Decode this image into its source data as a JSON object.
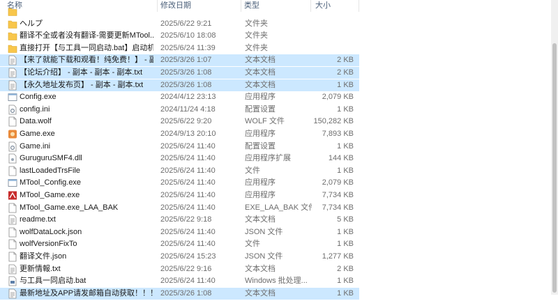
{
  "columns": {
    "name": "名称",
    "date": "修改日期",
    "type": "类型",
    "size": "大小"
  },
  "rows": [
    {
      "name": "",
      "date": "",
      "type": "",
      "size": "",
      "icon": "folder-icon",
      "selected": false,
      "partial": true
    },
    {
      "name": "ヘルプ",
      "date": "2025/6/22 9:21",
      "type": "文件夹",
      "size": "",
      "icon": "folder-icon",
      "selected": false
    },
    {
      "name": "翻译不全或者没有翻译-需要更新MTool...",
      "date": "2025/6/10 18:08",
      "type": "文件夹",
      "size": "",
      "icon": "folder-icon",
      "selected": false
    },
    {
      "name": "直接打开【与工具一同启动.bat】启动机翻",
      "date": "2025/6/24 11:39",
      "type": "文件夹",
      "size": "",
      "icon": "folder-icon",
      "selected": false
    },
    {
      "name": "【来了就能下载和观看！纯免费！】 - 副...",
      "date": "2025/3/26 1:07",
      "type": "文本文档",
      "size": "2 KB",
      "icon": "text-file-icon",
      "selected": true
    },
    {
      "name": "【论坛介绍】 - 副本 - 副本 - 副本.txt",
      "date": "2025/3/26 1:08",
      "type": "文本文档",
      "size": "2 KB",
      "icon": "text-file-icon",
      "selected": true
    },
    {
      "name": "【永久地址发布页】 - 副本 - 副本.txt",
      "date": "2025/3/26 1:08",
      "type": "文本文档",
      "size": "1 KB",
      "icon": "text-file-icon",
      "selected": true
    },
    {
      "name": "Config.exe",
      "date": "2024/4/12 23:13",
      "type": "应用程序",
      "size": "2,079 KB",
      "icon": "app-window-icon",
      "selected": false
    },
    {
      "name": "config.ini",
      "date": "2024/11/24 4:18",
      "type": "配置设置",
      "size": "1 KB",
      "icon": "settings-file-icon",
      "selected": false
    },
    {
      "name": "Data.wolf",
      "date": "2025/6/22 9:20",
      "type": "WOLF 文件",
      "size": "150,282 KB",
      "icon": "blank-file-icon",
      "selected": false
    },
    {
      "name": "Game.exe",
      "date": "2024/9/13 20:10",
      "type": "应用程序",
      "size": "7,893 KB",
      "icon": "game-app-icon",
      "selected": false
    },
    {
      "name": "Game.ini",
      "date": "2025/6/24 11:40",
      "type": "配置设置",
      "size": "1 KB",
      "icon": "settings-file-icon",
      "selected": false
    },
    {
      "name": "GuruguruSMF4.dll",
      "date": "2025/6/24 11:40",
      "type": "应用程序扩展",
      "size": "144 KB",
      "icon": "dll-file-icon",
      "selected": false
    },
    {
      "name": "lastLoadedTrsFile",
      "date": "2025/6/24 11:40",
      "type": "文件",
      "size": "1 KB",
      "icon": "blank-file-icon",
      "selected": false
    },
    {
      "name": "MTool_Config.exe",
      "date": "2025/6/24 11:40",
      "type": "应用程序",
      "size": "2,079 KB",
      "icon": "app-window-icon",
      "selected": false
    },
    {
      "name": "MTool_Game.exe",
      "date": "2025/6/24 11:40",
      "type": "应用程序",
      "size": "7,734 KB",
      "icon": "mtool-app-icon",
      "selected": false
    },
    {
      "name": "MTool_Game.exe_LAA_BAK",
      "date": "2025/6/24 11:40",
      "type": "EXE_LAA_BAK 文件",
      "size": "7,734 KB",
      "icon": "blank-file-icon",
      "selected": false
    },
    {
      "name": "readme.txt",
      "date": "2025/6/22 9:18",
      "type": "文本文档",
      "size": "5 KB",
      "icon": "text-file-icon",
      "selected": false
    },
    {
      "name": "wolfDataLock.json",
      "date": "2025/6/24 11:40",
      "type": "JSON 文件",
      "size": "1 KB",
      "icon": "blank-file-icon",
      "selected": false
    },
    {
      "name": "wolfVersionFixTo",
      "date": "2025/6/24 11:40",
      "type": "文件",
      "size": "1 KB",
      "icon": "blank-file-icon",
      "selected": false
    },
    {
      "name": "翻译文件.json",
      "date": "2025/6/24 15:23",
      "type": "JSON 文件",
      "size": "1,277 KB",
      "icon": "blank-file-icon",
      "selected": false
    },
    {
      "name": "更新情報.txt",
      "date": "2025/6/22 9:16",
      "type": "文本文档",
      "size": "2 KB",
      "icon": "text-file-icon",
      "selected": false
    },
    {
      "name": "与工具一同启动.bat",
      "date": "2025/6/24 11:40",
      "type": "Windows 批处理...",
      "size": "1 KB",
      "icon": "batch-file-icon",
      "selected": false
    },
    {
      "name": "最新地址及APP请发邮箱自动获取！！！",
      "date": "2025/3/26 1:08",
      "type": "文本文档",
      "size": "1 KB",
      "icon": "text-file-icon",
      "selected": true,
      "partial": true
    }
  ],
  "colors": {
    "selection": "#cce8ff",
    "folder": "#f8c64b",
    "header_text": "#4c607a"
  }
}
